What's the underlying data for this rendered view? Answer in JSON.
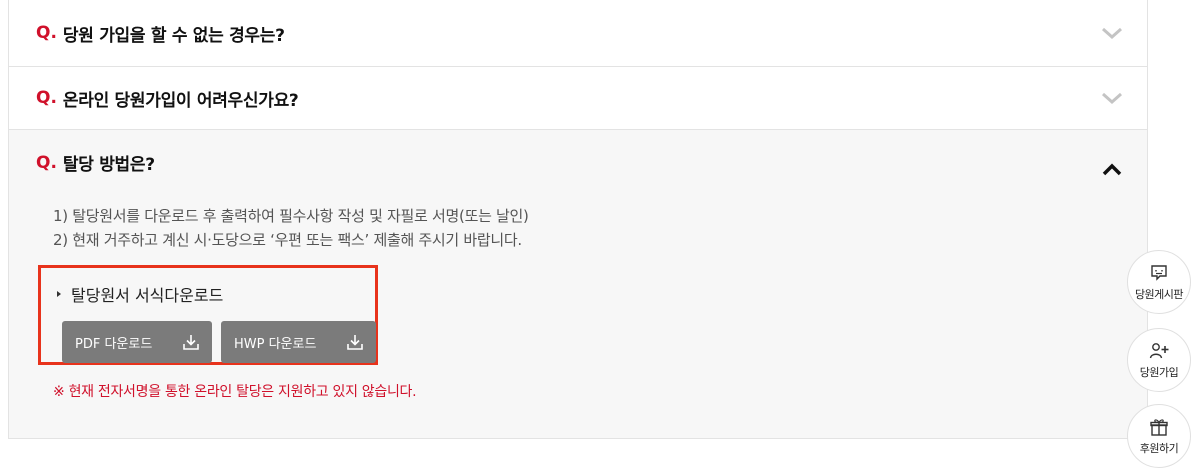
{
  "faq": {
    "items": [
      {
        "q_mark": "Q.",
        "question": "당원 가입을 할 수 없는 경우는?"
      },
      {
        "q_mark": "Q.",
        "question": "온라인 당원가입이 어려우신가요?"
      }
    ],
    "open_item": {
      "q_mark": "Q.",
      "question": "탈당 방법은?",
      "answer_lines": [
        "1) 탈당원서를 다운로드 후 출력하여 필수사항 작성 및 자필로 서명(또는 날인)",
        "2) 현재 거주하고 계신 시·도당으로 ‘우편 또는 팩스’ 제출해 주시기 바랍니다."
      ],
      "download": {
        "title": "탈당원서 서식다운로드",
        "pdf_label": "PDF 다운로드",
        "hwp_label": "HWP 다운로드"
      },
      "notice": "※ 현재 전자서명을 통한 온라인 탈당은 지원하고 있지 않습니다."
    }
  },
  "side_menu": {
    "board": "당원게시판",
    "join": "당원가입",
    "donate": "후원하기"
  },
  "colors": {
    "accent": "#d0112b",
    "highlight_box": "#e8331c",
    "button": "#7b7b7b"
  }
}
